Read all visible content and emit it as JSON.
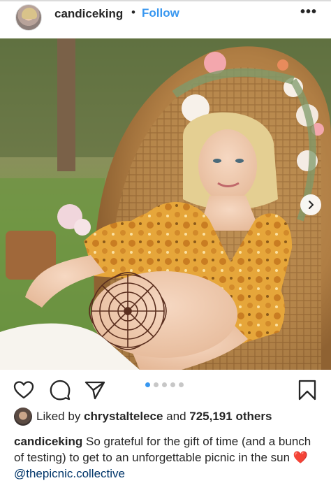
{
  "header": {
    "username": "candiceking",
    "separator": "•",
    "follow_label": "Follow",
    "more_label": "•••"
  },
  "post": {
    "image_alt": "Woman seated in a wicker peacock chair wearing a floral crown, yellow floral top with henna design on belly",
    "carousel": {
      "total": 5,
      "active_index": 0
    },
    "next_label": "›"
  },
  "actions": {
    "icons": [
      "heart-icon",
      "comment-icon",
      "share-icon",
      "bookmark-icon"
    ]
  },
  "likes": {
    "prefix": "Liked by ",
    "user": "chrystaltelece",
    "middle": " and ",
    "count": "725,191 others"
  },
  "caption": {
    "username": "candiceking",
    "text": " So grateful for the gift of time (and a bunch of testing) to get to an unforgettable picnic in the sun ",
    "emoji": "❤️",
    "mention": " @thepicnic.collective"
  },
  "colors": {
    "follow": "#3897f0",
    "pager_active": "#3897f0",
    "pager_inactive": "#c7c7c7",
    "text": "#262626"
  }
}
